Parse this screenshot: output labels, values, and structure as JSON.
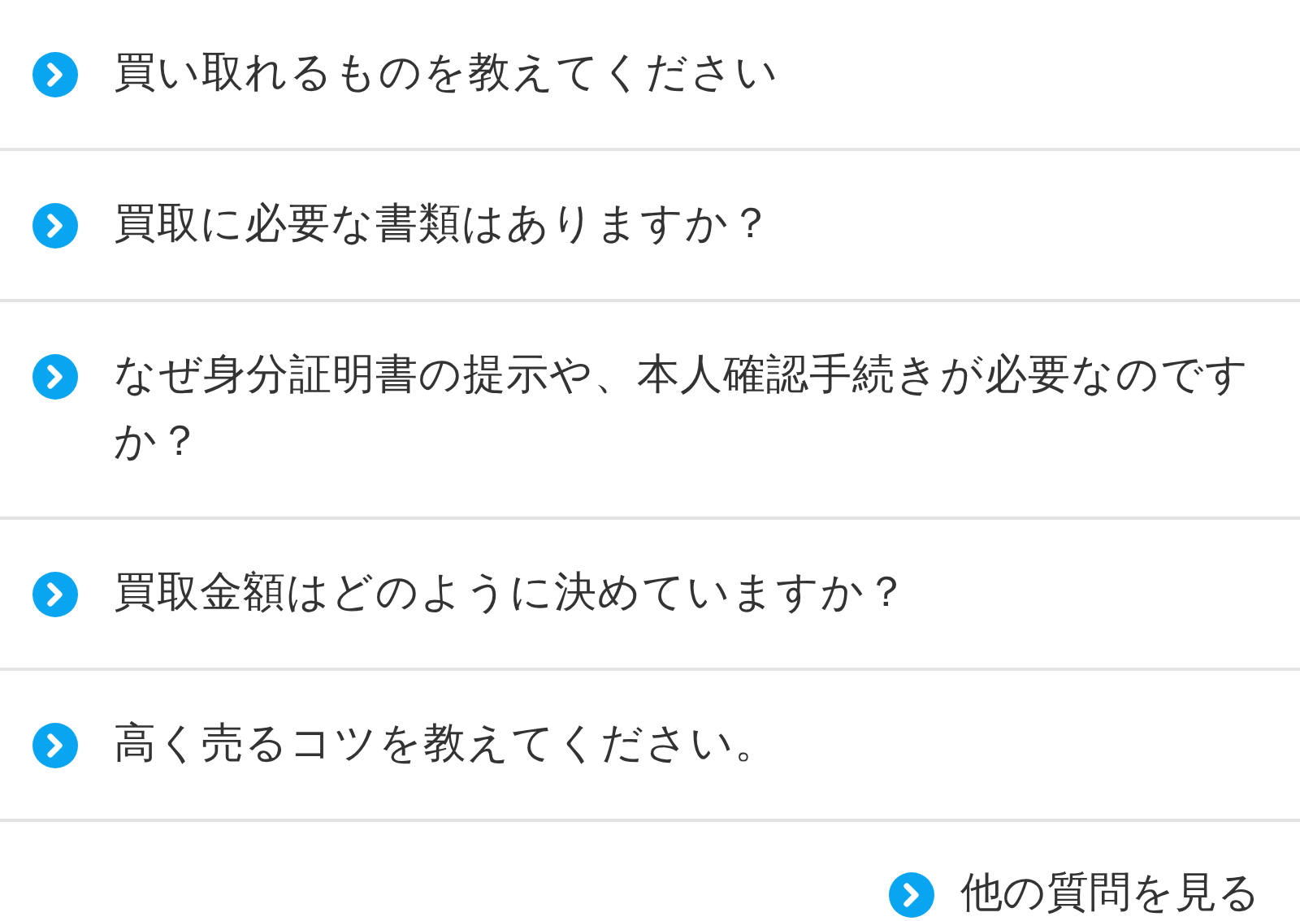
{
  "faq": [
    {
      "question": "買い取れるものを教えてください"
    },
    {
      "question": "買取に必要な書類はありますか？"
    },
    {
      "question": "なぜ身分証明書の提示や、本人確認手続きが必要なのですか？"
    },
    {
      "question": "買取金額はどのように決めていますか？"
    },
    {
      "question": "高く売るコツを教えてください。"
    }
  ],
  "more_link": "他の質問を見る"
}
